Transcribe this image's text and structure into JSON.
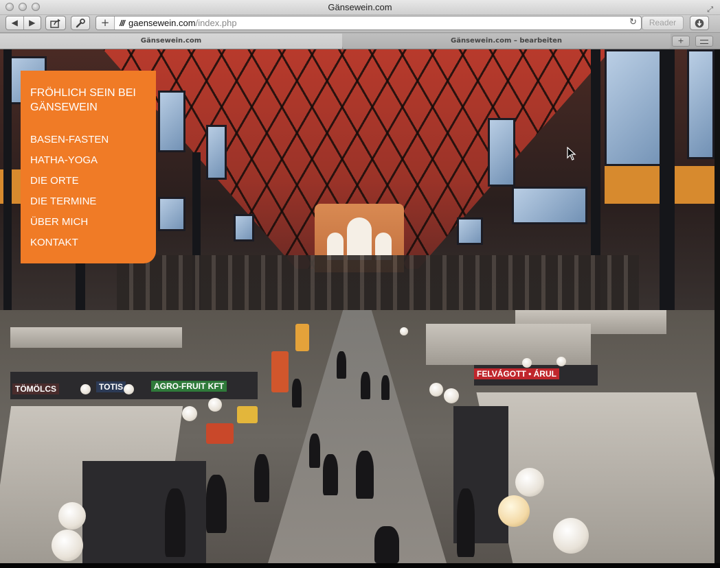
{
  "window": {
    "title": "Gänsewein.com"
  },
  "toolbar": {
    "back_label": "◀",
    "forward_label": "▶",
    "add_label": "+",
    "url_domain": "gaensewein.com",
    "url_path": "/index.php",
    "reload_icon": "reload-icon",
    "reader_label": "Reader"
  },
  "tabs": [
    {
      "label": "Gänsewein.com",
      "active": true
    },
    {
      "label": "Gänsewein.com – bearbeiten",
      "active": false
    }
  ],
  "menu": {
    "heading": "Fröhlich sein bei Gänsewein",
    "items": [
      {
        "label": "Basen-Fasten"
      },
      {
        "label": "Hatha-Yoga"
      },
      {
        "label": "Die Orte"
      },
      {
        "label": "Die Termine"
      },
      {
        "label": "Über mich"
      },
      {
        "label": "Kontakt"
      }
    ],
    "bg_color": "#f07b26"
  },
  "hero": {
    "signs": [
      "FELVÁGOTT • ÁRUL",
      "AGRO-FRUIT KFT",
      "TÖMÖLCS",
      "TOTIS"
    ]
  }
}
